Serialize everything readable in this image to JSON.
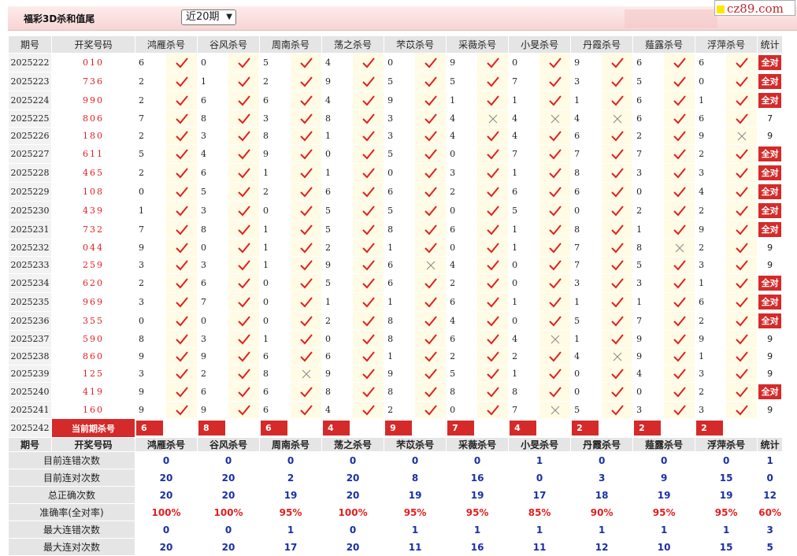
{
  "header": {
    "title": "福彩3D杀和值尾",
    "period_select": "近20期",
    "logo_text": "cz89.com"
  },
  "table": {
    "columns": [
      "期号",
      "开奖号码",
      "鸿雁杀号",
      "谷风杀号",
      "周南杀号",
      "荡之杀号",
      "芣苡杀号",
      "采薇杀号",
      "小旻杀号",
      "丹霞杀号",
      "薤露杀号",
      "浮萍杀号",
      "统计"
    ],
    "full_label": "全对",
    "rows": [
      {
        "issue": "2025222",
        "win": "010",
        "kills": [
          "6",
          "0",
          "5",
          "4",
          "0",
          "9",
          "0",
          "9",
          "6",
          "6"
        ],
        "ok": [
          1,
          1,
          1,
          1,
          1,
          1,
          1,
          1,
          1,
          1
        ],
        "stat": "全对"
      },
      {
        "issue": "2025223",
        "win": "736",
        "kills": [
          "2",
          "1",
          "2",
          "9",
          "5",
          "5",
          "7",
          "3",
          "5",
          "0"
        ],
        "ok": [
          1,
          1,
          1,
          1,
          1,
          1,
          1,
          1,
          1,
          1
        ],
        "stat": "全对"
      },
      {
        "issue": "2025224",
        "win": "990",
        "kills": [
          "2",
          "6",
          "6",
          "4",
          "9",
          "1",
          "1",
          "1",
          "6",
          "1"
        ],
        "ok": [
          1,
          1,
          1,
          1,
          1,
          1,
          1,
          1,
          1,
          1
        ],
        "stat": "全对"
      },
      {
        "issue": "2025225",
        "win": "806",
        "kills": [
          "7",
          "8",
          "3",
          "8",
          "3",
          "4",
          "4",
          "4",
          "6",
          "6"
        ],
        "ok": [
          1,
          1,
          1,
          1,
          1,
          0,
          0,
          0,
          1,
          1
        ],
        "stat": "7"
      },
      {
        "issue": "2025226",
        "win": "180",
        "kills": [
          "2",
          "3",
          "8",
          "1",
          "3",
          "4",
          "4",
          "6",
          "2",
          "9"
        ],
        "ok": [
          1,
          1,
          1,
          1,
          1,
          1,
          1,
          1,
          1,
          0
        ],
        "stat": "9"
      },
      {
        "issue": "2025227",
        "win": "611",
        "kills": [
          "5",
          "4",
          "9",
          "0",
          "5",
          "0",
          "7",
          "7",
          "7",
          "2"
        ],
        "ok": [
          1,
          1,
          1,
          1,
          1,
          1,
          1,
          1,
          1,
          1
        ],
        "stat": "全对"
      },
      {
        "issue": "2025228",
        "win": "465",
        "kills": [
          "2",
          "6",
          "1",
          "1",
          "0",
          "3",
          "1",
          "8",
          "3",
          "3"
        ],
        "ok": [
          1,
          1,
          1,
          1,
          1,
          1,
          1,
          1,
          1,
          1
        ],
        "stat": "全对"
      },
      {
        "issue": "2025229",
        "win": "108",
        "kills": [
          "0",
          "5",
          "2",
          "6",
          "6",
          "2",
          "6",
          "6",
          "0",
          "4"
        ],
        "ok": [
          1,
          1,
          1,
          1,
          1,
          1,
          1,
          1,
          1,
          1
        ],
        "stat": "全对"
      },
      {
        "issue": "2025230",
        "win": "439",
        "kills": [
          "1",
          "3",
          "0",
          "5",
          "5",
          "0",
          "5",
          "0",
          "2",
          "2"
        ],
        "ok": [
          1,
          1,
          1,
          1,
          1,
          1,
          1,
          1,
          1,
          1
        ],
        "stat": "全对"
      },
      {
        "issue": "2025231",
        "win": "732",
        "kills": [
          "7",
          "8",
          "1",
          "5",
          "8",
          "6",
          "1",
          "8",
          "1",
          "9"
        ],
        "ok": [
          1,
          1,
          1,
          1,
          1,
          1,
          1,
          1,
          1,
          1
        ],
        "stat": "全对"
      },
      {
        "issue": "2025232",
        "win": "044",
        "kills": [
          "9",
          "0",
          "1",
          "2",
          "1",
          "0",
          "1",
          "7",
          "8",
          "2"
        ],
        "ok": [
          1,
          1,
          1,
          1,
          1,
          1,
          1,
          1,
          0,
          1
        ],
        "stat": "9"
      },
      {
        "issue": "2025233",
        "win": "259",
        "kills": [
          "3",
          "3",
          "1",
          "9",
          "6",
          "4",
          "0",
          "7",
          "5",
          "3"
        ],
        "ok": [
          1,
          1,
          1,
          1,
          0,
          1,
          1,
          1,
          1,
          1
        ],
        "stat": "9"
      },
      {
        "issue": "2025234",
        "win": "620",
        "kills": [
          "2",
          "6",
          "0",
          "5",
          "6",
          "2",
          "0",
          "3",
          "3",
          "1"
        ],
        "ok": [
          1,
          1,
          1,
          1,
          1,
          1,
          1,
          1,
          1,
          1
        ],
        "stat": "全对"
      },
      {
        "issue": "2025235",
        "win": "969",
        "kills": [
          "3",
          "7",
          "0",
          "1",
          "1",
          "6",
          "1",
          "1",
          "1",
          "6"
        ],
        "ok": [
          1,
          1,
          1,
          1,
          1,
          1,
          1,
          1,
          1,
          1
        ],
        "stat": "全对"
      },
      {
        "issue": "2025236",
        "win": "355",
        "kills": [
          "0",
          "0",
          "0",
          "2",
          "8",
          "4",
          "0",
          "5",
          "7",
          "2"
        ],
        "ok": [
          1,
          1,
          1,
          1,
          1,
          1,
          1,
          1,
          1,
          1
        ],
        "stat": "全对"
      },
      {
        "issue": "2025237",
        "win": "590",
        "kills": [
          "8",
          "3",
          "1",
          "0",
          "8",
          "6",
          "4",
          "1",
          "9",
          "9"
        ],
        "ok": [
          1,
          1,
          1,
          1,
          1,
          1,
          0,
          1,
          1,
          1
        ],
        "stat": "9"
      },
      {
        "issue": "2025238",
        "win": "860",
        "kills": [
          "9",
          "9",
          "6",
          "6",
          "1",
          "2",
          "2",
          "4",
          "9",
          "1"
        ],
        "ok": [
          1,
          1,
          1,
          1,
          1,
          1,
          1,
          0,
          1,
          1
        ],
        "stat": "9"
      },
      {
        "issue": "2025239",
        "win": "125",
        "kills": [
          "3",
          "2",
          "8",
          "9",
          "9",
          "5",
          "1",
          "0",
          "4",
          "3"
        ],
        "ok": [
          1,
          1,
          0,
          1,
          1,
          1,
          1,
          1,
          1,
          1
        ],
        "stat": "9"
      },
      {
        "issue": "2025240",
        "win": "419",
        "kills": [
          "9",
          "6",
          "6",
          "8",
          "8",
          "8",
          "8",
          "0",
          "0",
          "2"
        ],
        "ok": [
          1,
          1,
          1,
          1,
          1,
          1,
          1,
          1,
          1,
          1
        ],
        "stat": "全对"
      },
      {
        "issue": "2025241",
        "win": "160",
        "kills": [
          "9",
          "9",
          "6",
          "4",
          "2",
          "0",
          "7",
          "5",
          "3",
          "3"
        ],
        "ok": [
          1,
          1,
          1,
          1,
          1,
          1,
          0,
          1,
          1,
          1
        ],
        "stat": "9"
      }
    ],
    "current": {
      "issue": "2025242",
      "label": "当前期杀号",
      "kills": [
        "6",
        "8",
        "6",
        "4",
        "9",
        "7",
        "4",
        "2",
        "2",
        "2"
      ]
    }
  },
  "summary": {
    "columns": [
      "期号",
      "开奖号码",
      "鸿雁杀号",
      "谷风杀号",
      "周南杀号",
      "荡之杀号",
      "芣苡杀号",
      "采薇杀号",
      "小旻杀号",
      "丹霞杀号",
      "薤露杀号",
      "浮萍杀号",
      "统计"
    ],
    "rows": [
      {
        "label": "目前连错次数",
        "values": [
          "0",
          "0",
          "0",
          "0",
          "0",
          "0",
          "1",
          "0",
          "0",
          "0",
          "1"
        ],
        "red": false
      },
      {
        "label": "目前连对次数",
        "values": [
          "20",
          "20",
          "2",
          "20",
          "8",
          "16",
          "0",
          "3",
          "9",
          "15",
          "0"
        ],
        "red": false
      },
      {
        "label": "总正确次数",
        "values": [
          "20",
          "20",
          "19",
          "20",
          "19",
          "19",
          "17",
          "18",
          "19",
          "19",
          "12"
        ],
        "red": false
      },
      {
        "label": "准确率(全对率)",
        "values": [
          "100%",
          "100%",
          "95%",
          "100%",
          "95%",
          "95%",
          "85%",
          "90%",
          "95%",
          "95%",
          "60%"
        ],
        "red": true
      },
      {
        "label": "最大连错次数",
        "values": [
          "0",
          "0",
          "1",
          "0",
          "1",
          "1",
          "1",
          "1",
          "1",
          "1",
          "3"
        ],
        "red": false
      },
      {
        "label": "最大连对次数",
        "values": [
          "20",
          "20",
          "17",
          "20",
          "11",
          "16",
          "11",
          "12",
          "10",
          "15",
          "5"
        ],
        "red": false
      }
    ]
  },
  "colors": {
    "accent_red": "#d52a2a",
    "check_red": "#e02020",
    "stat_blue": "#1a2fa8",
    "cell_yellow": "#fffbe5"
  },
  "icons": {
    "ok": "checkmark-icon",
    "bad": "cross-icon"
  }
}
